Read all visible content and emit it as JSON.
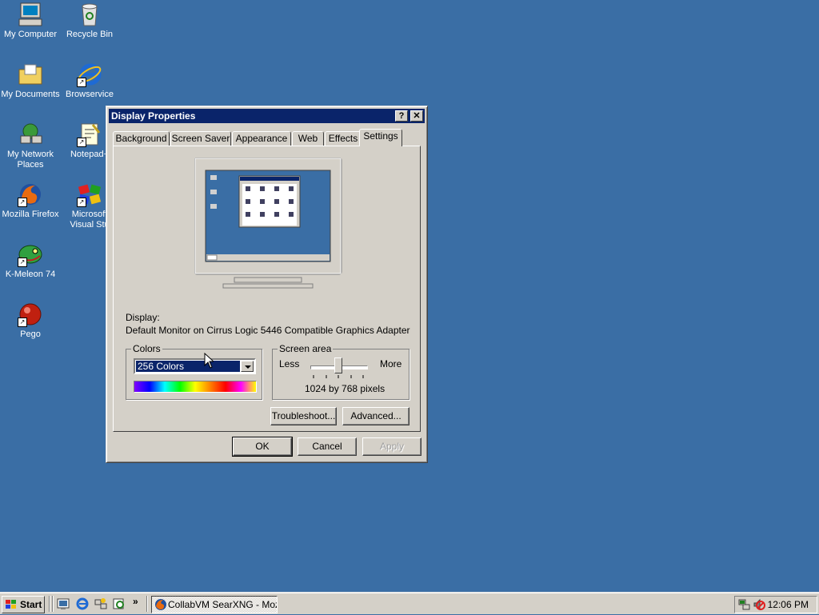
{
  "desktop": {
    "icons": [
      {
        "label": "My Computer",
        "icon": "my-computer-icon"
      },
      {
        "label": "Recycle Bin",
        "icon": "recycle-bin-icon"
      },
      {
        "label": "My Documents",
        "icon": "my-documents-icon"
      },
      {
        "label": "Browservice",
        "icon": "internet-explorer-icon"
      },
      {
        "label": "My Network Places",
        "icon": "network-places-icon"
      },
      {
        "label": "Notepad+",
        "icon": "notepad-icon"
      },
      {
        "label": "Mozilla Firefox",
        "icon": "firefox-icon"
      },
      {
        "label": "Microsoft Visual Stu",
        "icon": "visual-studio-icon"
      },
      {
        "label": "K-Meleon 74",
        "icon": "k-meleon-icon"
      },
      {
        "label": "Pego",
        "icon": "pego-icon"
      }
    ],
    "background_color": "#3a6ea5"
  },
  "dialog": {
    "title": "Display Properties",
    "help_button": "?",
    "close_button": "✕",
    "tabs": [
      "Background",
      "Screen Saver",
      "Appearance",
      "Web",
      "Effects",
      "Settings"
    ],
    "active_tab": "Settings",
    "display_label": "Display:",
    "display_value": "Default Monitor on Cirrus Logic 5446 Compatible Graphics Adapter",
    "colors": {
      "legend": "Colors",
      "selected": "256 Colors"
    },
    "screen_area": {
      "legend": "Screen area",
      "less": "Less",
      "more": "More",
      "value": "1024 by 768 pixels",
      "slider_position": 0.5
    },
    "troubleshoot_button": "Troubleshoot...",
    "advanced_button": "Advanced...",
    "ok_button": "OK",
    "cancel_button": "Cancel",
    "apply_button": "Apply"
  },
  "taskbar": {
    "start_label": "Start",
    "chevron": "»",
    "task_label": "CollabVM SearXNG - Mozil...",
    "clock": "12:06 PM"
  }
}
